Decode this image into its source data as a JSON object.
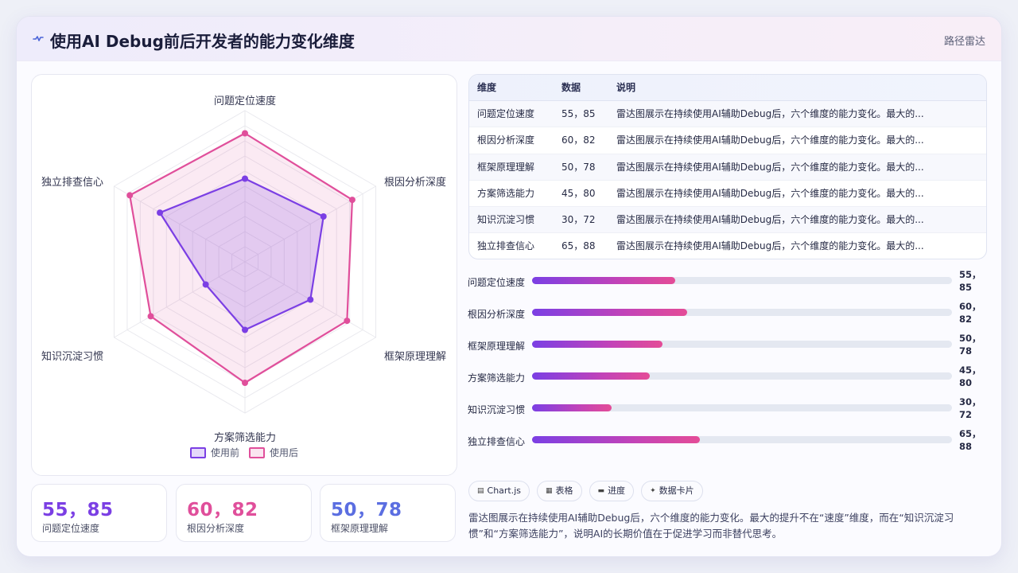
{
  "header": {
    "title": "使用AI Debug前后开发者的能力变化维度",
    "subtitle": "路径雷达"
  },
  "legend": {
    "before": "使用前",
    "after": "使用后"
  },
  "colors": {
    "before": "#7b3fe4",
    "after": "#e04f9b",
    "accent_blue": "#5b6ee1"
  },
  "chart_data": {
    "type": "radar",
    "categories": [
      "问题定位速度",
      "根因分析深度",
      "框架原理理解",
      "方案筛选能力",
      "知识沉淀习惯",
      "独立排查信心"
    ],
    "series": [
      {
        "name": "使用前",
        "values": [
          55,
          60,
          50,
          45,
          30,
          65
        ]
      },
      {
        "name": "使用后",
        "values": [
          85,
          82,
          78,
          80,
          72,
          88
        ]
      }
    ],
    "range": [
      0,
      100
    ],
    "grid_levels": 5
  },
  "table": {
    "headers": [
      "维度",
      "数据",
      "说明"
    ],
    "rows": [
      [
        "问题定位速度",
        "55，85",
        "雷达图展示在持续使用AI辅助Debug后，六个维度的能力变化。最大的..."
      ],
      [
        "根因分析深度",
        "60，82",
        "雷达图展示在持续使用AI辅助Debug后，六个维度的能力变化。最大的..."
      ],
      [
        "框架原理理解",
        "50，78",
        "雷达图展示在持续使用AI辅助Debug后，六个维度的能力变化。最大的..."
      ],
      [
        "方案筛选能力",
        "45，80",
        "雷达图展示在持续使用AI辅助Debug后，六个维度的能力变化。最大的..."
      ],
      [
        "知识沉淀习惯",
        "30，72",
        "雷达图展示在持续使用AI辅助Debug后，六个维度的能力变化。最大的..."
      ],
      [
        "独立排查信心",
        "65，88",
        "雷达图展示在持续使用AI辅助Debug后，六个维度的能力变化。最大的..."
      ]
    ]
  },
  "bars": [
    {
      "label": "问题定位速度",
      "value_text": "55，85",
      "fill": 0.34
    },
    {
      "label": "根因分析深度",
      "value_text": "60，82",
      "fill": 0.37
    },
    {
      "label": "框架原理理解",
      "value_text": "50，78",
      "fill": 0.31
    },
    {
      "label": "方案筛选能力",
      "value_text": "45，80",
      "fill": 0.28
    },
    {
      "label": "知识沉淀习惯",
      "value_text": "30，72",
      "fill": 0.19
    },
    {
      "label": "独立排查信心",
      "value_text": "65，88",
      "fill": 0.4
    }
  ],
  "stats": [
    {
      "value": "55，85",
      "label": "问题定位速度",
      "color": "#7b3fe4"
    },
    {
      "value": "60，82",
      "label": "根因分析深度",
      "color": "#e04f9b"
    },
    {
      "value": "50，78",
      "label": "框架原理理解",
      "color": "#5b6ee1"
    }
  ],
  "chips": [
    {
      "icon": "chart-icon",
      "label": "Chart.js"
    },
    {
      "icon": "table-icon",
      "label": "表格"
    },
    {
      "icon": "progress-icon",
      "label": "进度"
    },
    {
      "icon": "sparkle-icon",
      "label": "数据卡片"
    }
  ],
  "description": "雷达图展示在持续使用AI辅助Debug后，六个维度的能力变化。最大的提升不在“速度”维度，而在“知识沉淀习惯”和“方案筛选能力”，说明AI的长期价值在于促进学习而非替代思考。"
}
